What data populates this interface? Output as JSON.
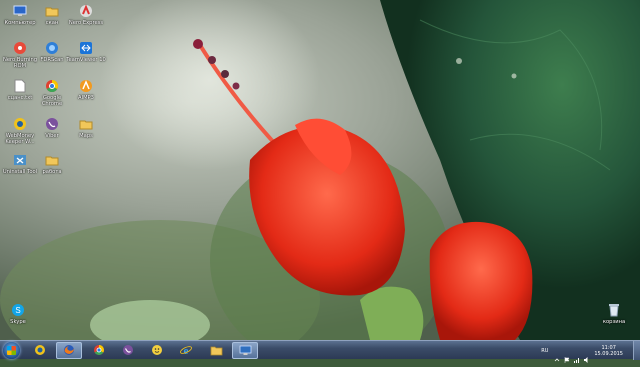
{
  "desktop": {
    "icons": [
      {
        "label": "Компьютер",
        "icon": "computer-icon"
      },
      {
        "label": "скан",
        "icon": "folder-icon"
      },
      {
        "label": "Nero Express",
        "icon": "nero-express-icon"
      },
      {
        "label": "Nero Burning ROM",
        "icon": "nero-burning-rom-icon"
      },
      {
        "label": "FDRScan",
        "icon": "fdrscan-icon"
      },
      {
        "label": "TeamViewer 10",
        "icon": "teamviewer-icon"
      },
      {
        "label": "сцанс.txt",
        "icon": "text-file-icon"
      },
      {
        "label": "Google Chrome",
        "icon": "chrome-icon"
      },
      {
        "label": "AIMP3",
        "icon": "aimp-icon"
      },
      {
        "label": "WebMoney Keeper W...",
        "icon": "webmoney-icon"
      },
      {
        "label": "Viber",
        "icon": "viber-icon"
      },
      {
        "label": "Maps",
        "icon": "folder-icon"
      },
      {
        "label": "Uninstall Tool",
        "icon": "uninstall-tool-icon"
      },
      {
        "label": "работа",
        "icon": "folder-icon"
      },
      {
        "label": "Skype",
        "icon": "skype-icon"
      },
      {
        "label": "корзина",
        "icon": "recycle-bin-icon"
      }
    ]
  },
  "taskbar": {
    "start": "start-orb-icon",
    "pinned": [
      {
        "icon": "webmoney-icon"
      },
      {
        "icon": "firefox-icon"
      },
      {
        "icon": "chrome-icon"
      },
      {
        "icon": "viber-icon"
      },
      {
        "icon": "messenger-icon"
      },
      {
        "icon": "internet-explorer-icon"
      },
      {
        "icon": "explorer-folder-icon"
      },
      {
        "icon": "remote-desktop-icon"
      }
    ],
    "tray": {
      "language": "RU",
      "time": "11:07",
      "date": "15.09.2015"
    }
  },
  "colors": {
    "flower": "#e8321f",
    "leaf": "#2d6b3e",
    "taskbar": "#3b4c68"
  }
}
